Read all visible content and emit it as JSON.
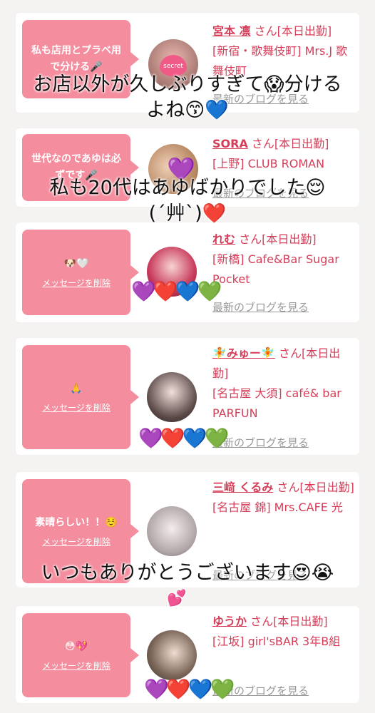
{
  "cards": [
    {
      "message": "私も店用とプラベ用で分ける🎤",
      "delete_label": "メッセージを削除",
      "name": "宮本 凛",
      "suffix": "さん[本日出勤]",
      "shop": "[新宿・歌舞伎町] Mrs.J 歌舞伎町",
      "blog": "最新のブログを見る",
      "avatar_text": "secret"
    },
    {
      "message": "世代なのであゆは必ずです🎤",
      "delete_label": "メッセージを削除",
      "name": "SORA",
      "suffix": "さん[本日出勤]",
      "shop": "[上野] CLUB ROMAN",
      "blog": "最新のブログを見る"
    },
    {
      "message": "🐶🤍",
      "delete_label": "メッセージを削除",
      "name": "れむ",
      "suffix": "さん[本日出勤]",
      "shop": "[新橋] Cafe&Bar Sugar Pocket",
      "blog": "最新のブログを見る"
    },
    {
      "message": "🙏",
      "delete_label": "メッセージを削除",
      "name": "🧚みゅー🧚",
      "suffix": "さん[本日出勤]",
      "shop": "[名古屋 大須] café& bar PARFUN",
      "blog": "最新のブログを見る"
    },
    {
      "message": "素晴らしい！！☺️",
      "delete_label": "メッセージを削除",
      "name": "三﨑 くるみ",
      "suffix": "さん[本日出勤]",
      "shop": "[名古屋 錦] Mrs.CAFE 光",
      "blog": "最新のブログを見る"
    },
    {
      "message": "😳💖",
      "delete_label": "メッセージを削除",
      "name": "ゆうか",
      "suffix": "さん[本日出勤]",
      "shop": "[江坂] girl'sBAR 3年B組",
      "blog": "最新のブログを見る"
    }
  ],
  "overlays": {
    "text1_line1": "お店以外が久しぶりすぎて😱分ける",
    "text1_line2": "よね😙💙",
    "text2_line1": "私も20代はあゆばかりでした😌",
    "text2_line2": "(´艸`)❤️",
    "text3_line1": "いつもありがとうございます😍😭",
    "text3_line2": "💕"
  },
  "stickers": {
    "hearts": "💜❤️💙💚",
    "purple_heart": "💜"
  },
  "colors": {
    "bubble": "#f48d9d",
    "name": "#d53d58",
    "blog": "#999999"
  }
}
